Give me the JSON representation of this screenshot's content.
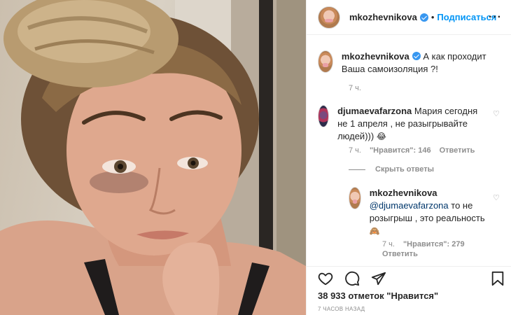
{
  "post": {
    "username": "mkozhevnikova",
    "separator": "•",
    "follow_label": "Подписаться",
    "more_icon": "more-horizontal-icon"
  },
  "caption": {
    "username": "mkozhevnikova",
    "text": "А как проходит Ваша самоизоляция ?!",
    "time": "7 ч."
  },
  "comment": {
    "username": "djumaevafarzona",
    "text": "Мария сегодня не 1 апреля , не разыгрывайте людей)))",
    "emoji": "😂",
    "time": "7 ч.",
    "likes": "\"Нравится\": 146",
    "reply_label": "Ответить"
  },
  "hide_replies_label": "Скрыть ответы",
  "reply": {
    "username": "mkozhevnikova",
    "mention": "@djumaevafarzona",
    "text": "то не розыгрыш , это реальность",
    "emoji": "🙈",
    "time": "7 ч.",
    "likes": "\"Нравится\": 279",
    "reply_label": "Ответить"
  },
  "footer": {
    "likes_text": "38 933 отметок \"Нравится\"",
    "timestamp": "7 часов назад"
  },
  "colors": {
    "link_blue": "#0095f6",
    "verified_blue": "#3897f0",
    "secondary_text": "#8e8e8e",
    "primary_text": "#262626"
  }
}
